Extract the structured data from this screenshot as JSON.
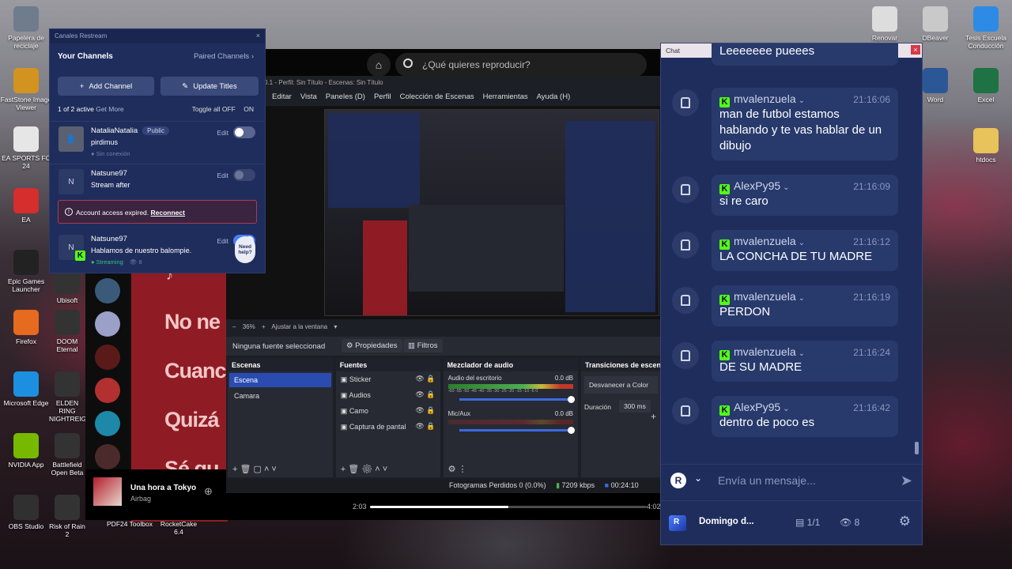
{
  "desktop_left": [
    {
      "label": "Papelera de reciclaje",
      "icon": "recycle-bin-icon",
      "color": "#6e7c8c"
    },
    {
      "label": "FastStone Image Viewer",
      "icon": "eye-icon",
      "color": "#d39320"
    },
    {
      "label": "EA SPORTS FC 24",
      "icon": "fc-icon",
      "color": "#e6e6e6"
    },
    {
      "label": "EA",
      "icon": "ea-icon",
      "color": "#d62d2d"
    },
    {
      "label": "Epic Games Launcher",
      "icon": "epic-icon",
      "color": "#222222"
    },
    {
      "label": "Firefox",
      "icon": "firefox-icon",
      "color": "#e66a1f"
    },
    {
      "label": "Microsoft Edge",
      "icon": "edge-icon",
      "color": "#1d8fe0"
    },
    {
      "label": "NVIDIA App",
      "icon": "nvidia-icon",
      "color": "#76b900"
    },
    {
      "label": "OBS Studio",
      "icon": "obs-icon",
      "color": "#303030"
    }
  ],
  "desktop_left2": [
    {
      "label": "Ubisoft",
      "icon": "ubisoft-icon"
    },
    {
      "label": "DOOM Eternal",
      "icon": "doom-icon"
    },
    {
      "label": "ELDEN RING NIGHTREIGN",
      "icon": "elden-icon"
    },
    {
      "label": "Battlefield Open Beta",
      "icon": "bf-icon"
    },
    {
      "label": "Risk of Rain 2",
      "icon": "ror2-icon"
    }
  ],
  "desktop_right": [
    {
      "label": "Renovar",
      "icon": "renew-icon",
      "color": "#dddddd"
    },
    {
      "label": "DBeaver",
      "icon": "dbeaver-icon",
      "color": "#c9c9c9"
    },
    {
      "label": "Tesis Escuela Conducción",
      "icon": "windows-folder-icon",
      "color": "#2d8be6"
    },
    {
      "label": "Word",
      "icon": "word-icon",
      "color": "#2b5797"
    },
    {
      "label": "Excel",
      "icon": "excel-icon",
      "color": "#1f7244"
    },
    {
      "label": "htdocs",
      "icon": "folder-icon",
      "color": "#e8c25a"
    }
  ],
  "taskbar_labels": {
    "pdf": "PDF24 Toolbox",
    "rocket": "RocketCake 6.4"
  },
  "spotify": {
    "search_placeholder": "¿Qué quieres reproducir?",
    "lyrics": [
      "No ne",
      "Cuanc",
      "Quizá",
      "Sé qu"
    ],
    "track": "Una hora a Tokyo",
    "artist": "Airbag",
    "time_elapsed": "2:03",
    "time_total": "4:02",
    "progress": 0.5
  },
  "obs": {
    "title": "0.1 - Perfil: Sin Título - Escenas: Sin Título",
    "menu": [
      "Editar",
      "Vista",
      "Paneles (D)",
      "Perfil",
      "Colección de Escenas",
      "Herramientas",
      "Ayuda (H)"
    ],
    "zoom": "36%",
    "fit": "Ajustar a la ventana",
    "no_source": "Ninguna fuente seleccionad",
    "properties": "Propiedades",
    "filters": "Filtros",
    "scenes_title": "Escenas",
    "scenes": [
      "Escena",
      "Camara"
    ],
    "sources_title": "Fuentes",
    "sources": [
      {
        "name": "Sticker",
        "icon": "sticker-icon"
      },
      {
        "name": "Audios",
        "icon": "audio-icon"
      },
      {
        "name": "Camo",
        "icon": "camera-icon"
      },
      {
        "name": "Captura de pantal",
        "icon": "monitor-icon"
      }
    ],
    "mixer_title": "Mezclador de audio",
    "mixer": [
      {
        "name": "Audio del escritorio",
        "db": "0.0 dB"
      },
      {
        "name": "Mic/Aux",
        "db": "0.0 dB"
      }
    ],
    "meter_ticks": "-60 -55 -50 -45 -40 -35 -30 -25 -20 -15 -10 -5 0",
    "transitions_title": "Transiciones de escen",
    "transition": "Desvanecer a Color",
    "duration_label": "Duración",
    "duration": "300 ms",
    "status": {
      "dropped": "Fotogramas Perdidos 0 (0.0%)",
      "kbps": "7209 kbps",
      "time": "00:24:10"
    }
  },
  "restream": {
    "window_title": "Canales Restream",
    "your_channels": "Your Channels",
    "paired_channels": "Paired Channels",
    "add_channel": "Add Channel",
    "update_titles": "Update Titles",
    "active_count": "1 of 2 active",
    "get_more": "Get More",
    "toggle_all": "Toggle all",
    "off": "OFF",
    "on": "ON",
    "edit": "Edit",
    "channels": [
      {
        "name": "NataliaNatalia",
        "badge": "Public",
        "title": "pirdimus",
        "state": "Sin conexión",
        "enabled": false
      },
      {
        "name": "Natsune97",
        "badge": "",
        "title": "Stream after",
        "state": "",
        "enabled": false
      },
      {
        "name": "Natsune97",
        "badge": "",
        "title": "Hablamos de nuestro balompie.",
        "state": "Streaming",
        "viewers": "8",
        "enabled": true
      }
    ],
    "alert": "Account access expired.",
    "alert_link": "Reconnect",
    "need_help": "Need help?"
  },
  "chat": {
    "window_title": "Chat",
    "messages": [
      {
        "user": "",
        "time": "",
        "text": "Leeeeeee pueees"
      },
      {
        "user": "mvalenzuela",
        "time": "21:16:06",
        "text": "man de futbol estamos hablando y te vas hablar de un dibujo"
      },
      {
        "user": "AlexPy95",
        "time": "21:16:09",
        "text": "si re caro"
      },
      {
        "user": "mvalenzuela",
        "time": "21:16:12",
        "text": "LA CONCHA DE TU MADRE"
      },
      {
        "user": "mvalenzuela",
        "time": "21:16:19",
        "text": "PERDON"
      },
      {
        "user": "mvalenzuela",
        "time": "21:16:24",
        "text": "DE SU MADRE"
      },
      {
        "user": "AlexPy95",
        "time": "21:16:42",
        "text": "dentro de poco es"
      }
    ],
    "input_placeholder": "Envía un mensaje...",
    "event_title": "Domingo d...",
    "sources": "1/1",
    "viewers": "8"
  },
  "colors": {
    "restream_bg": "#1f2d5c",
    "kick_green": "#53fc18",
    "obs_blue": "#2a4cb1"
  }
}
